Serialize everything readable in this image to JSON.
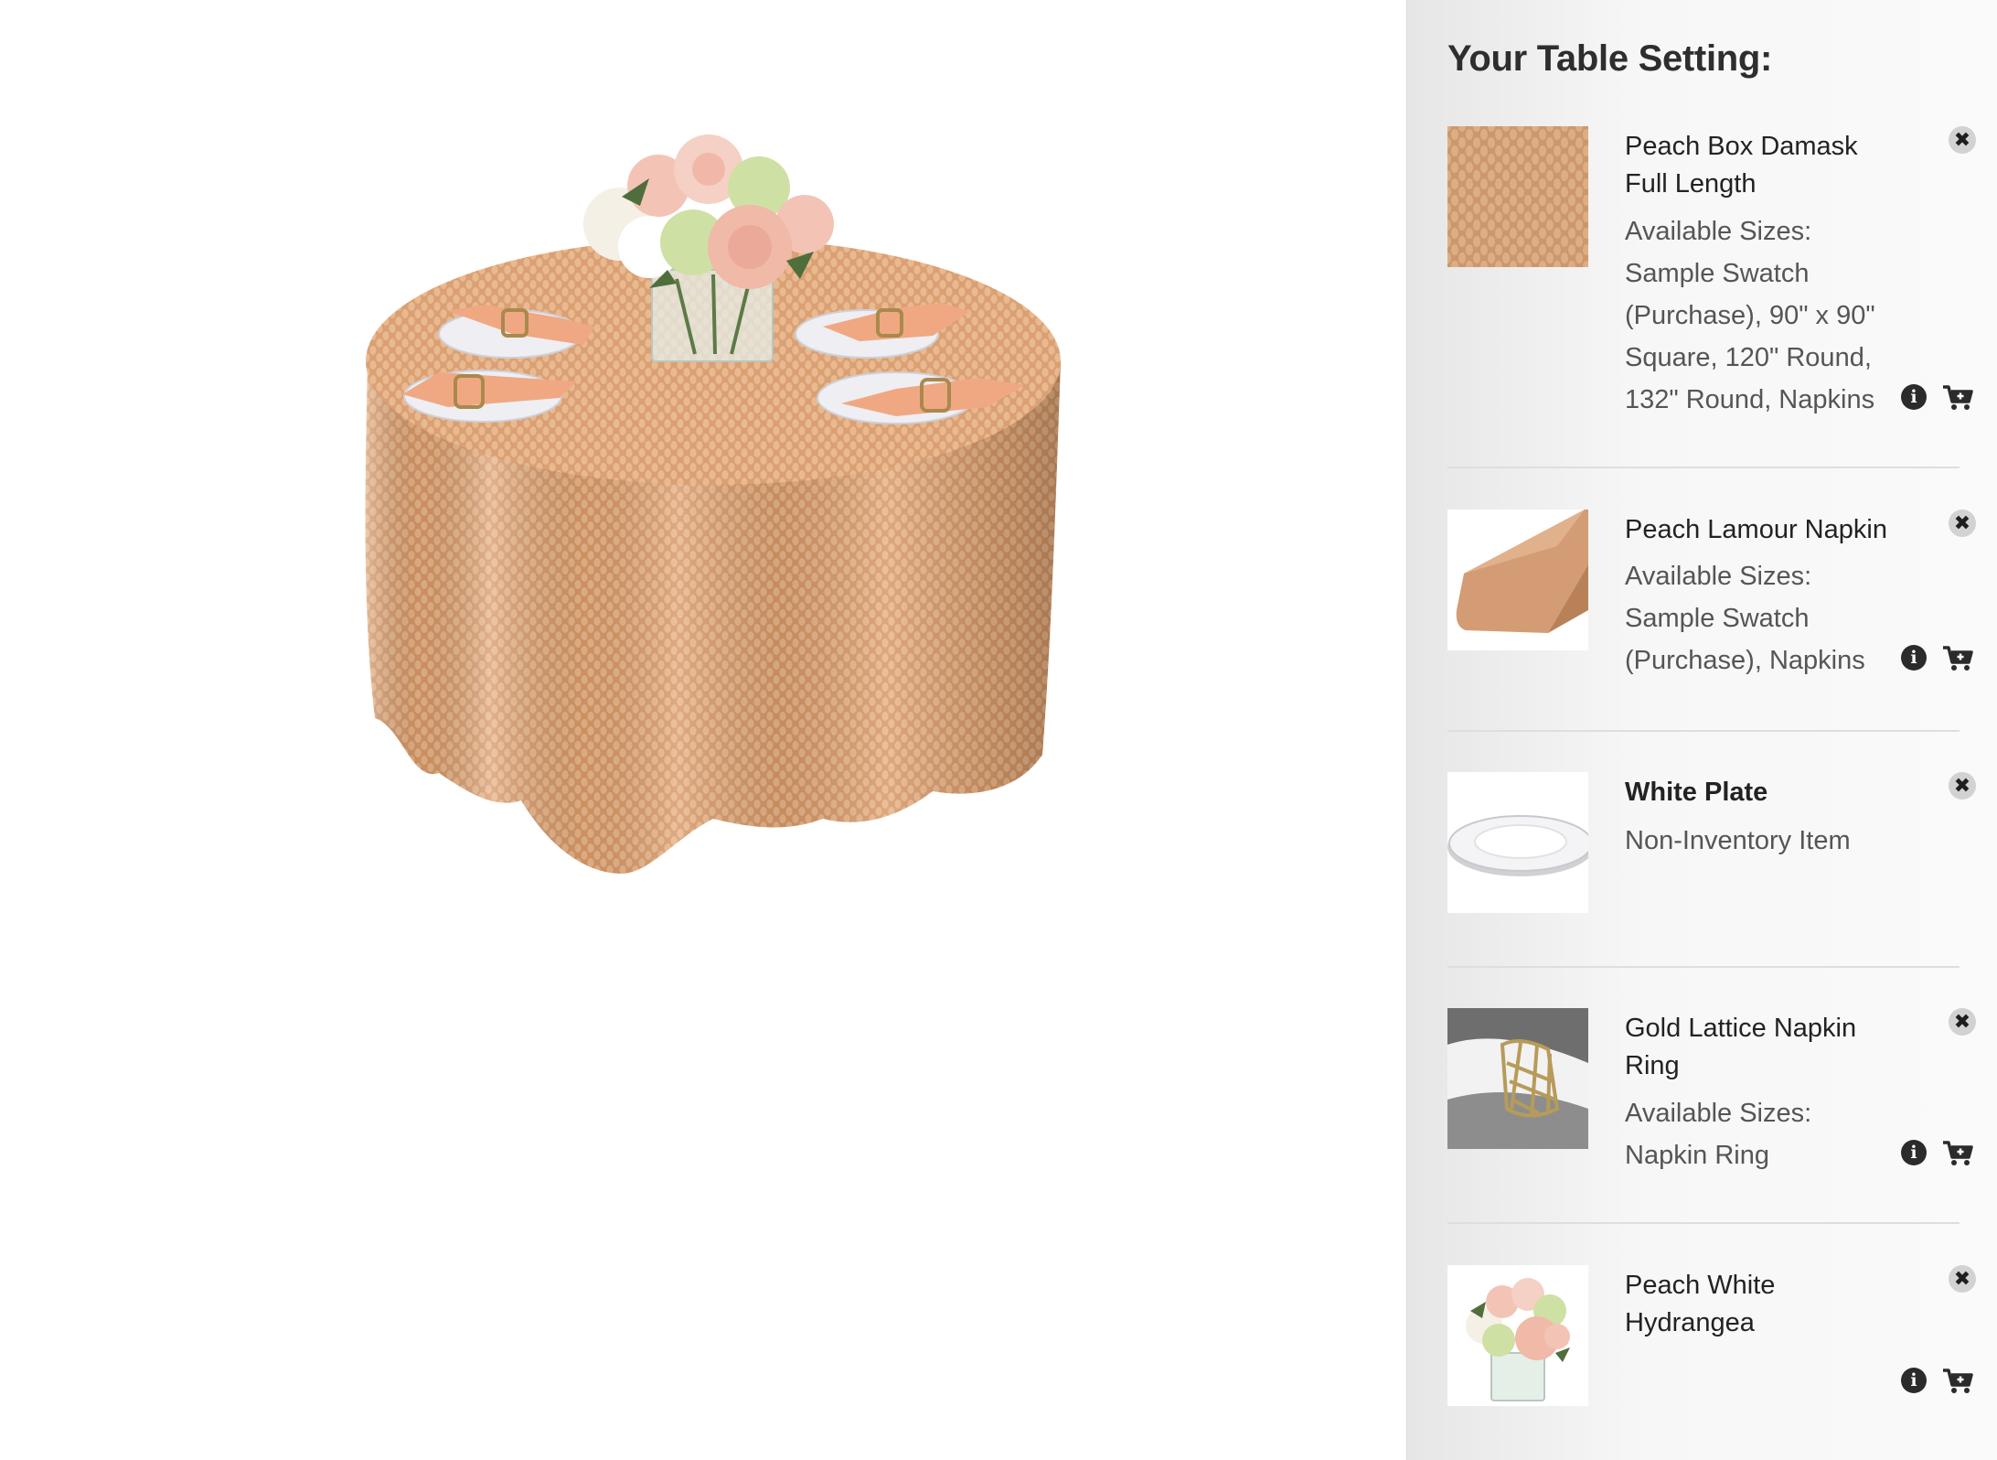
{
  "panel": {
    "title": "Your Table Setting:",
    "items": [
      {
        "name": "Peach Box Damask Full Length",
        "label": "Available Sizes:",
        "sizes": "Sample Swatch (Purchase), 90\" x 90\" Square, 120\" Round, 132\" Round, Napkins",
        "thumb_icon": "peach-damask-fabric-thumbnail",
        "remove_icon": "close-icon",
        "info_icon": "info-icon",
        "cart_icon": "cart-plus-icon"
      },
      {
        "name": "Peach Lamour Napkin",
        "label": "Available Sizes:",
        "sizes": "Sample Swatch (Purchase), Napkins",
        "thumb_icon": "peach-napkin-thumbnail",
        "remove_icon": "close-icon",
        "info_icon": "info-icon",
        "cart_icon": "cart-plus-icon"
      },
      {
        "name": "White Plate",
        "label": "Non-Inventory Item",
        "thumb_icon": "white-plate-thumbnail",
        "remove_icon": "close-icon"
      },
      {
        "name": "Gold Lattice Napkin Ring",
        "label": "Available Sizes:",
        "sizes": "Napkin Ring",
        "thumb_icon": "gold-napkin-ring-thumbnail",
        "remove_icon": "close-icon",
        "info_icon": "info-icon",
        "cart_icon": "cart-plus-icon"
      },
      {
        "name": "Peach White Hydrangea",
        "thumb_icon": "flower-centerpiece-thumbnail",
        "remove_icon": "close-icon",
        "info_icon": "info-icon",
        "cart_icon": "cart-plus-icon"
      }
    ]
  },
  "colors": {
    "tablecloth": "#d89a6c",
    "napkin": "#f0a883",
    "napkin_ring": "#a9894c",
    "plate": "#eeeef3",
    "panel_background": "#f5f5f5",
    "text_dark": "#222222",
    "text_muted": "#555555"
  }
}
